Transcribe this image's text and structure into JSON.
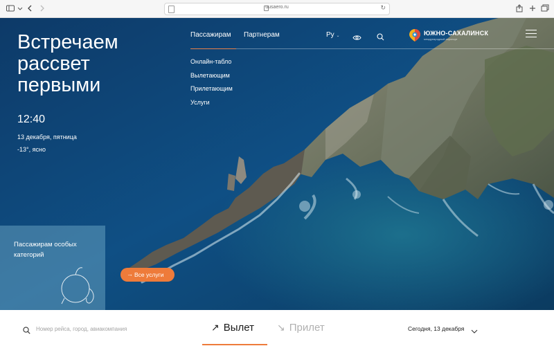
{
  "browser": {
    "url": "uusaero.ru",
    "icons": [
      "sidebar-icon",
      "chevron-down-icon",
      "back-icon",
      "forward-icon",
      "share-icon",
      "new-tab-icon",
      "tabs-icon"
    ]
  },
  "hero": {
    "title": "Встречаем\nрассвет\nпервыми",
    "time": "12:40",
    "date": "13 декабря, пятница",
    "weather": "-13°, ясно"
  },
  "nav": {
    "tabs": [
      {
        "label": "Пассажирам",
        "active": true
      },
      {
        "label": "Партнерам",
        "active": false
      }
    ],
    "submenu": [
      "Онлайн-табло",
      "Вылетающим",
      "Прилетающим",
      "Услуги"
    ],
    "language": "Ру",
    "logo_text": "ЮЖНО-САХАЛИНСК",
    "logo_subtitle": "международный аэропорт"
  },
  "special_card": {
    "text": "Пассажирам особых категорий",
    "button_label": "Все услуги"
  },
  "flight_search": {
    "placeholder": "Номер рейса, город, авиакомпания",
    "departures_label": "Вылет",
    "arrivals_label": "Прилет",
    "date_value": "Сегодня, 13 декабря"
  },
  "colors": {
    "accent": "#ee7b3a",
    "sea": "#0f4a7a"
  }
}
